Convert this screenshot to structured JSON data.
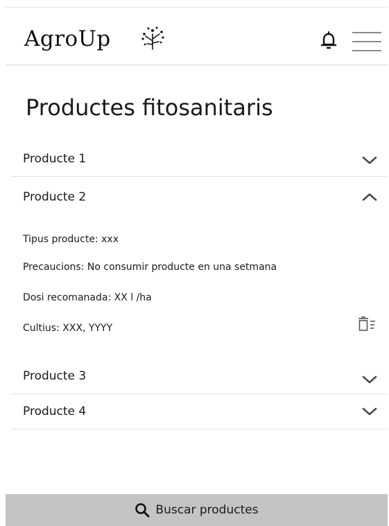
{
  "header": {
    "logo_text": "AgroUp",
    "icons": [
      "sprout-logo-icon",
      "bell-icon",
      "hamburger-menu-icon"
    ]
  },
  "page": {
    "title": "Productes fitosanitaris"
  },
  "products": [
    {
      "name": "Producte 1",
      "expanded": false
    },
    {
      "name": "Producte 2",
      "expanded": true,
      "details": {
        "type": "Tipus producte: xxx",
        "precautions": "Precaucions: No consumir producte en una setmana",
        "dose": "Dosi recomanada: XX l /ha",
        "crops": "Cultius: XXX, YYYY"
      }
    },
    {
      "name": "Producte 3",
      "expanded": false
    },
    {
      "name": "Producte 4",
      "expanded": false
    }
  ],
  "search": {
    "label": "Buscar productes",
    "icon": "search-icon"
  },
  "colors": {
    "search_bar_bg": "#c4c4c4",
    "divider": "#e2e2e2",
    "chevron": "#4a4a4a"
  }
}
